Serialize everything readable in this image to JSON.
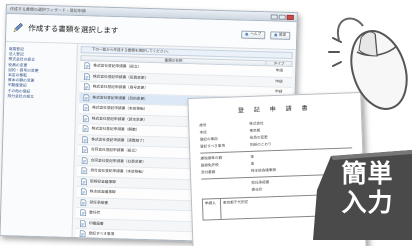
{
  "window": {
    "title": "作成する書類の選択ウィザード - 登記申請"
  },
  "header": {
    "heading": "作成する書類を選択します",
    "button_1": "ヘルプ",
    "button_2": "設定"
  },
  "sidebar": {
    "items": [
      "商業登記",
      "法人登記",
      "株式会社の設立",
      "役員の変更",
      "目的・商号の変更",
      "本店の移転",
      "資本の額の変更",
      "不動産登記",
      "その他の登記",
      "持分会社の設立"
    ]
  },
  "main": {
    "instruction": "下の一覧から作成する書類を選択してください。",
    "col_name": "書類の名称",
    "col_type": "タイプ",
    "rows": [
      {
        "name": "株式会社登記申請書（設立）",
        "type": "申請"
      },
      {
        "name": "株式会社登記申請書（役員変更）",
        "type": "申請"
      },
      {
        "name": "株式会社登記申請書（商号変更）",
        "type": "申請"
      },
      {
        "name": "株式会社登記申請書（目的変更）",
        "type": "申請"
      },
      {
        "name": "株式会社登記申請書（本店移転）",
        "type": "申請"
      },
      {
        "name": "株式会社登記申請書（資本変更）",
        "type": "申請"
      },
      {
        "name": "株式会社登記申請書（解散）",
        "type": "申請"
      },
      {
        "name": "株式会社登記申請書（清算結了）",
        "type": "申請"
      },
      {
        "name": "合同会社登記申請書（設立）",
        "type": "申請"
      },
      {
        "name": "合同会社登記申請書（社員変更）",
        "type": "申請"
      },
      {
        "name": "持分会社登記申請書（本店移転）",
        "type": "申請"
      },
      {
        "name": "取締役会議事録",
        "type": "添付"
      },
      {
        "name": "株主総会議事録",
        "type": "添付"
      },
      {
        "name": "就任承諾書",
        "type": "添付"
      },
      {
        "name": "委任状",
        "type": "添付"
      },
      {
        "name": "印鑑届書",
        "type": "添付"
      },
      {
        "name": "登記すべき事項",
        "type": "添付"
      }
    ],
    "footer_button": "選択した書類を作成"
  },
  "document": {
    "title": "登 記 申 請 書",
    "lines": [
      [
        "商号",
        "株式会社"
      ],
      [
        "本店",
        "東京都"
      ],
      [
        "登記の事由",
        "役員の変更"
      ],
      [
        "登記すべき事項",
        "別紙のとおり"
      ],
      [
        "課税標準の額",
        "金"
      ],
      [
        "登録免許税",
        "金"
      ],
      [
        "添付書類",
        "株主総会議事録"
      ],
      [
        "",
        "就任承諾書"
      ],
      [
        "",
        "委任状"
      ]
    ],
    "box_label": "申請人",
    "box_value": "東京都千代田区"
  },
  "badge": {
    "line_1": "簡単",
    "line_2": "入力",
    "color": "#4a4a4a"
  }
}
